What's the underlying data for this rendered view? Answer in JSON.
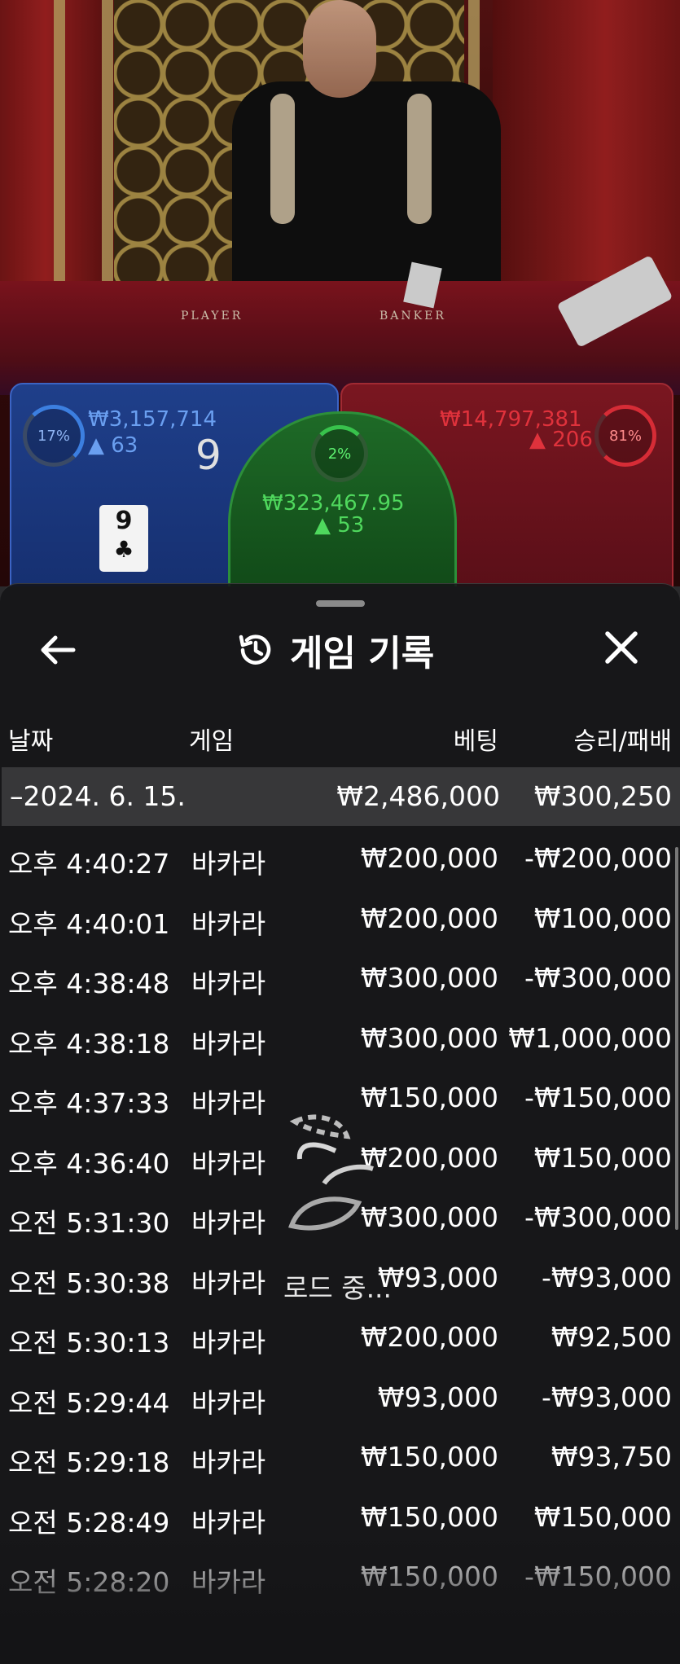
{
  "stage": {
    "felt_player": "PLAYER",
    "felt_banker": "BANKER"
  },
  "bets": {
    "player": {
      "percent": "17%",
      "amount": "₩3,157,714",
      "players": "63",
      "score": "9",
      "card_rank": "9",
      "card_suit": "♣"
    },
    "tie": {
      "percent": "2%",
      "amount": "₩323,467.95",
      "players": "53"
    },
    "banker": {
      "percent": "81%",
      "amount": "₩14,797,381",
      "players": "206"
    }
  },
  "history": {
    "title": "게임 기록",
    "columns": {
      "date": "날짜",
      "game": "게임",
      "bet": "베팅",
      "win_loss": "승리/패배"
    },
    "date_group": {
      "date": "–2024. 6. 15.",
      "bet": "₩2,486,000",
      "win_loss": "₩300,250"
    },
    "rows": [
      {
        "time": "오후 4:40:27",
        "game": "바카라",
        "bet": "₩200,000",
        "win_loss": "-₩200,000"
      },
      {
        "time": "오후 4:40:01",
        "game": "바카라",
        "bet": "₩200,000",
        "win_loss": "₩100,000"
      },
      {
        "time": "오후 4:38:48",
        "game": "바카라",
        "bet": "₩300,000",
        "win_loss": "-₩300,000"
      },
      {
        "time": "오후 4:38:18",
        "game": "바카라",
        "bet": "₩300,000",
        "win_loss": "₩1,000,000"
      },
      {
        "time": "오후 4:37:33",
        "game": "바카라",
        "bet": "₩150,000",
        "win_loss": "-₩150,000"
      },
      {
        "time": "오후 4:36:40",
        "game": "바카라",
        "bet": "₩200,000",
        "win_loss": "₩150,000"
      },
      {
        "time": "오전 5:31:30",
        "game": "바카라",
        "bet": "₩300,000",
        "win_loss": "-₩300,000"
      },
      {
        "time": "오전 5:30:38",
        "game": "바카라",
        "bet": "₩93,000",
        "win_loss": "-₩93,000"
      },
      {
        "time": "오전 5:30:13",
        "game": "바카라",
        "bet": "₩200,000",
        "win_loss": "₩92,500"
      },
      {
        "time": "오전 5:29:44",
        "game": "바카라",
        "bet": "₩93,000",
        "win_loss": "-₩93,000"
      },
      {
        "time": "오전 5:29:18",
        "game": "바카라",
        "bet": "₩150,000",
        "win_loss": "₩93,750"
      },
      {
        "time": "오전 5:28:49",
        "game": "바카라",
        "bet": "₩150,000",
        "win_loss": "₩150,000"
      },
      {
        "time": "오전 5:28:20",
        "game": "바카라",
        "bet": "₩150,000",
        "win_loss": "-₩150,000"
      }
    ],
    "loading_text": "로드 중..."
  },
  "colors": {
    "player": "#3c64c4",
    "banker": "#d62c36",
    "tie": "#38c24c",
    "sheet_bg": "#141416"
  },
  "icons": [
    "back-arrow-icon",
    "history-clock-icon",
    "close-icon",
    "loading-spinner-icon",
    "person-icon"
  ]
}
